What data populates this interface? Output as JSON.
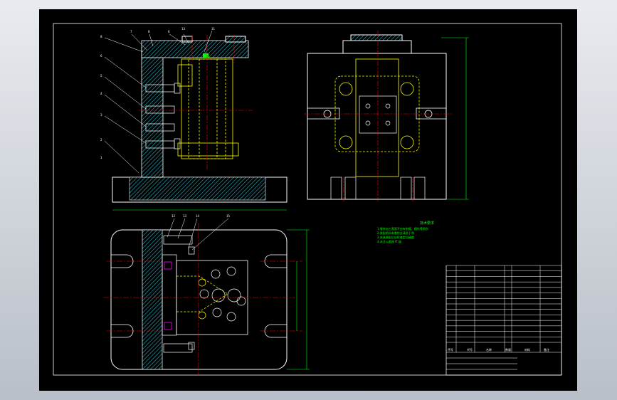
{
  "drawing": {
    "balloons_front": [
      "8",
      "7",
      "8",
      "6",
      "13",
      "11",
      "6",
      "5",
      "4",
      "3",
      "2",
      "1"
    ],
    "balloons_plan": [
      "12",
      "13",
      "14",
      "15"
    ],
    "tech_notes_title": "技术要求",
    "tech_notes": [
      "1.零件加工表面不应有划痕、擦伤等损伤",
      "2.装配前所有零件应清洗干净",
      "3.夹具装配后应检查定位精度",
      "4.未注公差按 IT 级"
    ],
    "title_block": {
      "rows": 14,
      "cols": 6,
      "footer": [
        "序号",
        "代号",
        "名称",
        "数量",
        "材料",
        "备注"
      ]
    },
    "colors": {
      "sheet": "#000000",
      "outline": "#ffffff",
      "center_line": "#ff0000",
      "hidden": "#ffff00",
      "hatch": "#2ab3c4",
      "dim": "#00ff00",
      "part_mark": "#ff00ff"
    }
  }
}
